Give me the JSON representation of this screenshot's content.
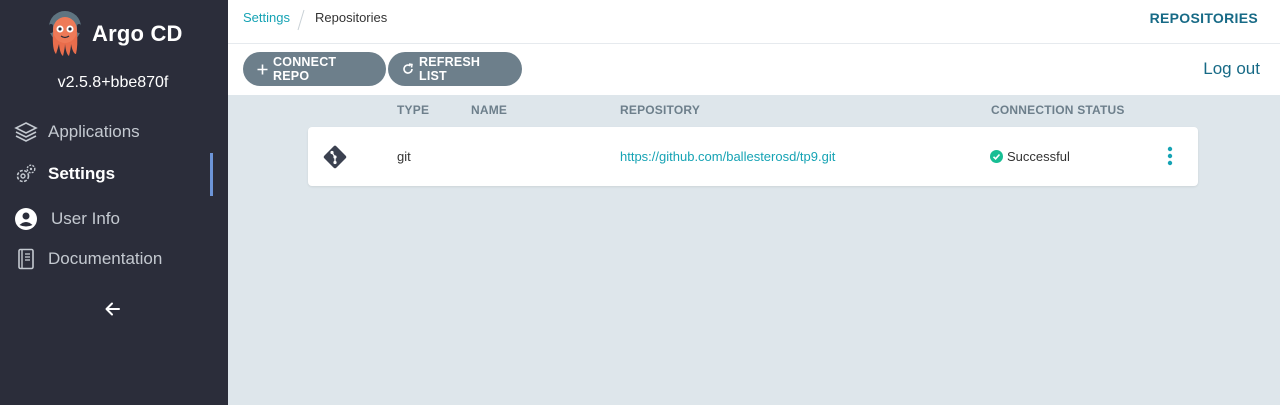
{
  "sidebar": {
    "app_name": "Argo CD",
    "version": "v2.5.8+bbe870f",
    "items": [
      {
        "label": "Applications",
        "icon": "layers-icon"
      },
      {
        "label": "Settings",
        "icon": "gear-icon",
        "active": true
      },
      {
        "label": "User Info",
        "icon": "user-icon"
      },
      {
        "label": "Documentation",
        "icon": "book-icon"
      }
    ],
    "collapse_icon": "arrow-left-icon"
  },
  "header": {
    "breadcrumb": [
      "Settings",
      "Repositories"
    ],
    "page_title": "REPOSITORIES"
  },
  "toolbar": {
    "connect_label": "CONNECT REPO",
    "refresh_label": "REFRESH LIST",
    "logout_label": "Log out"
  },
  "table": {
    "columns": [
      "TYPE",
      "NAME",
      "REPOSITORY",
      "CONNECTION STATUS"
    ],
    "rows": [
      {
        "type": "git",
        "name": "",
        "repository": "https://github.com/ballesterosd/tp9.git",
        "status": "Successful"
      }
    ]
  },
  "colors": {
    "sidebar_bg": "#2b2d3a",
    "accent": "#16a3b4",
    "button_bg": "#6d7f8b",
    "success": "#18be94"
  }
}
